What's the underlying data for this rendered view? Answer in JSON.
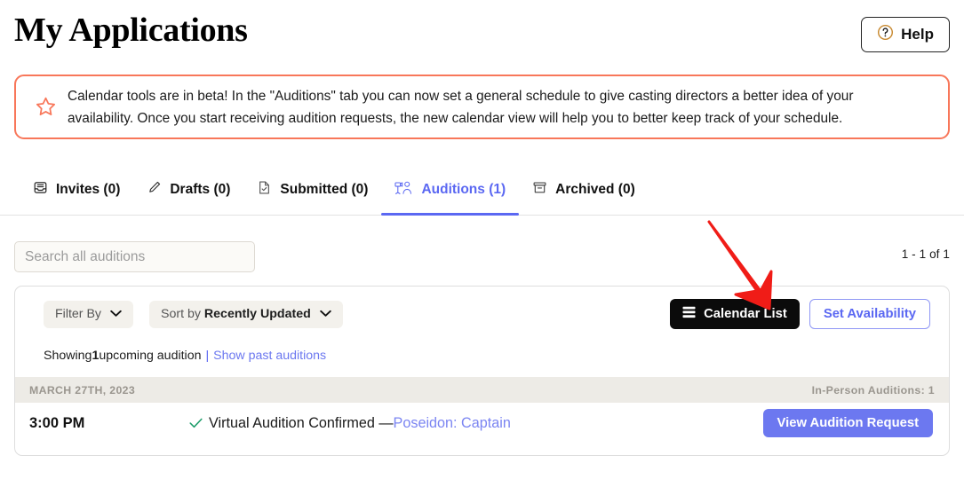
{
  "header": {
    "title": "My Applications",
    "help_label": "Help",
    "help_icon": "question-circle-icon"
  },
  "banner": {
    "icon": "star-outline-icon",
    "line1": "Calendar tools are in beta! In the \"Auditions\" tab you can now set a general schedule to give casting directors a better idea of your",
    "line2": "availability. Once you start receiving audition requests, the new calendar view will help you to better keep track of your schedule.",
    "border_color": "#F8775A"
  },
  "tabs": [
    {
      "label": "Invites (0)",
      "icon": "inbox-icon",
      "active": false
    },
    {
      "label": "Drafts (0)",
      "icon": "pencil-icon",
      "active": false
    },
    {
      "label": "Submitted (0)",
      "icon": "document-check-icon",
      "active": false
    },
    {
      "label": "Auditions (1)",
      "icon": "camera-person-icon",
      "active": true
    },
    {
      "label": "Archived (0)",
      "icon": "archive-box-icon",
      "active": false
    }
  ],
  "search": {
    "placeholder": "Search all auditions",
    "value": ""
  },
  "pagination": {
    "range": "1 - 1 of 1"
  },
  "toolbar": {
    "filter_label": "Filter By",
    "sort_prefix": "Sort by ",
    "sort_value": "Recently Updated",
    "calendar_list_label": "Calendar List",
    "calendar_list_icon": "list-lines-icon",
    "set_availability_label": "Set Availability"
  },
  "showing": {
    "prefix": "Showing ",
    "count": "1",
    "suffix": " upcoming audition ",
    "separator": "|",
    "past_link": "Show past auditions"
  },
  "date_group": {
    "date": "MARCH 27TH, 2023",
    "summary": "In-Person Auditions: 1"
  },
  "audition": {
    "time": "3:00 PM",
    "check_icon": "checkmark-icon",
    "status": "Virtual Audition Confirmed — ",
    "role": "Poseidon: Captain",
    "view_button_label": "View Audition Request"
  },
  "annotation": {
    "arrow": "red-down-right-arrow",
    "color": "#F01C17"
  },
  "colors": {
    "accent_blue": "#5B68F2",
    "button_blue": "#6C78F0",
    "coral": "#F8775A",
    "green": "#1F9D6B",
    "black_button": "#0b0b0b"
  }
}
